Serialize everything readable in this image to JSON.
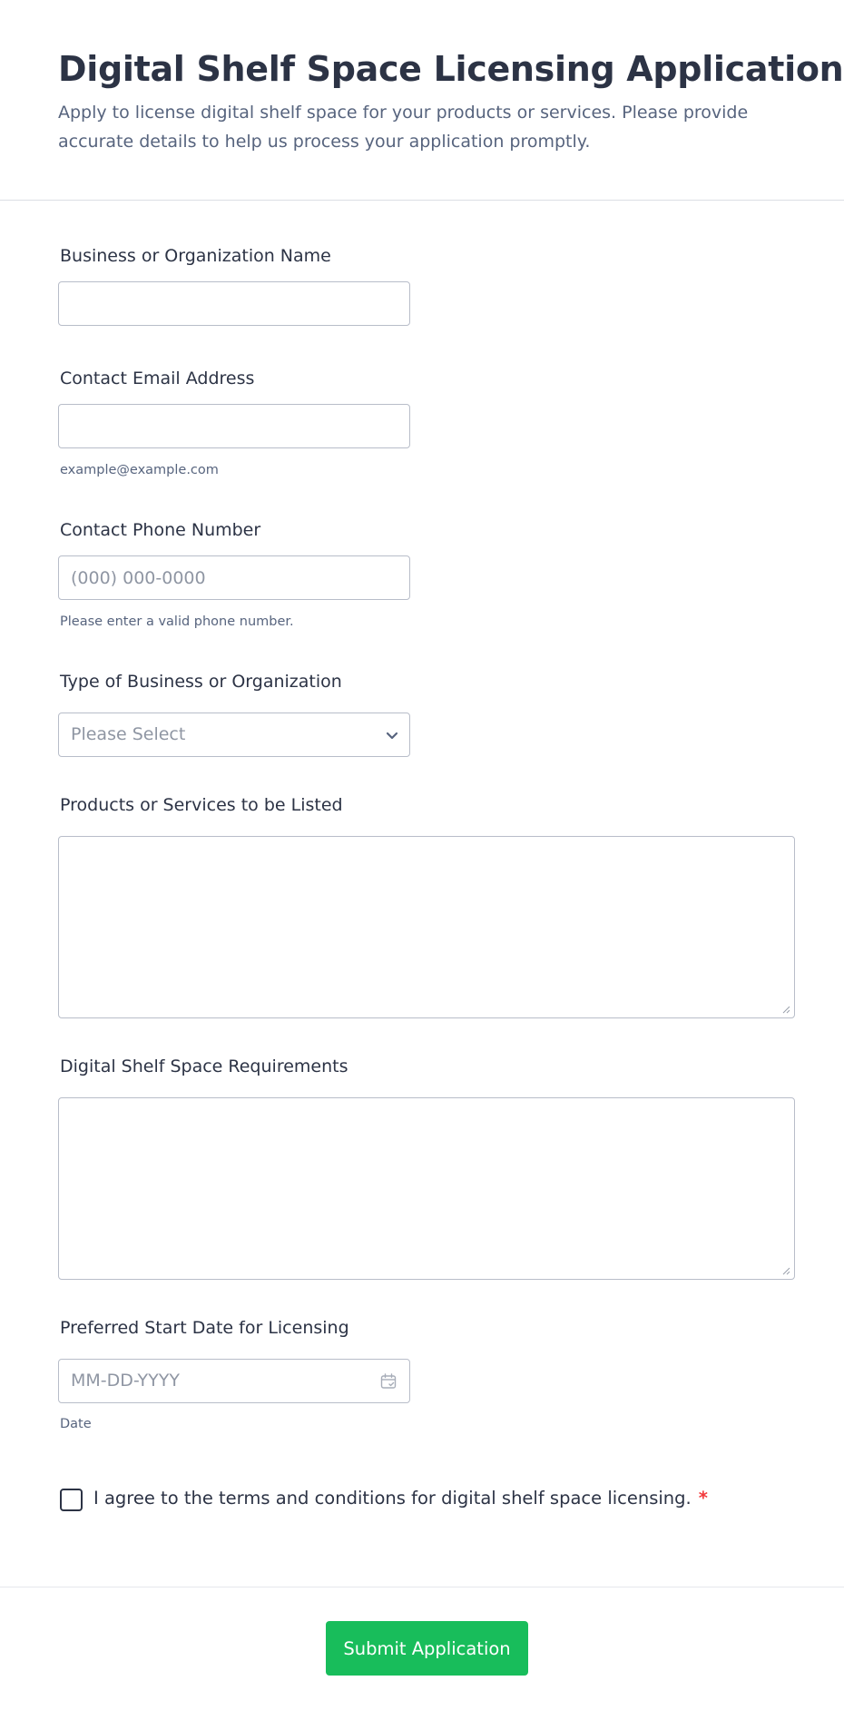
{
  "form": {
    "title": "Digital Shelf Space Licensing Application",
    "subtitle": "Apply to license digital shelf space for your products or services. Please provide accurate details to help us process your application promptly."
  },
  "fields": {
    "business_name": {
      "label": "Business or Organization Name",
      "value": ""
    },
    "email": {
      "label": "Contact Email Address",
      "value": "",
      "sublabel": "example@example.com"
    },
    "phone": {
      "label": "Contact Phone Number",
      "placeholder": "(000) 000-0000",
      "sublabel": "Please enter a valid phone number."
    },
    "business_type": {
      "label": "Type of Business or Organization",
      "selected": "Please Select",
      "icon": "chevron-down-icon"
    },
    "products": {
      "label": "Products or Services to be Listed",
      "value": ""
    },
    "requirements": {
      "label": "Digital Shelf Space Requirements",
      "value": ""
    },
    "start_date": {
      "label": "Preferred Start Date for Licensing",
      "placeholder": "MM-DD-YYYY",
      "sublabel": "Date",
      "icon": "calendar-icon"
    }
  },
  "agreement": {
    "label": "I agree to the terms and conditions for digital shelf space licensing.",
    "required_marker": "*",
    "checked": false
  },
  "submit": {
    "label": "Submit Application"
  },
  "colors": {
    "text": "#2c3345",
    "muted": "#57647e",
    "placeholder": "#8f96a3",
    "border": "#b8bdc9",
    "required": "#f23a3c",
    "submit_bg": "#18bd5b"
  }
}
